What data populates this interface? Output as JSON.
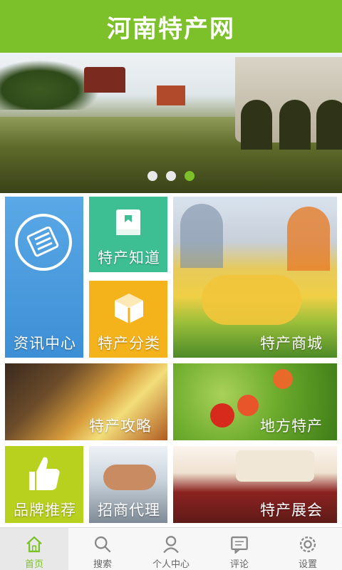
{
  "app": {
    "title": "河南特产网"
  },
  "banner": {
    "dots": 3,
    "active_dot": 2
  },
  "tiles": {
    "news": "资讯中心",
    "knowledge": "特产知道",
    "category": "特产分类",
    "mall": "特产商城",
    "guide": "特产攻略",
    "local": "地方特产",
    "brand": "品牌推荐",
    "agent": "招商代理",
    "expo": "特产展会"
  },
  "tabbar": {
    "items": [
      {
        "label": "首页",
        "icon": "home-icon"
      },
      {
        "label": "搜索",
        "icon": "search-icon"
      },
      {
        "label": "个人中心",
        "icon": "user-icon"
      },
      {
        "label": "评论",
        "icon": "comment-icon"
      },
      {
        "label": "设置",
        "icon": "gear-icon"
      }
    ],
    "active_index": 0
  },
  "colors": {
    "brand": "#7dc12a",
    "news": "#4a9ce0",
    "knowledge": "#3dbf93",
    "category": "#f4b21b",
    "brand_tile": "#b8d11f"
  }
}
